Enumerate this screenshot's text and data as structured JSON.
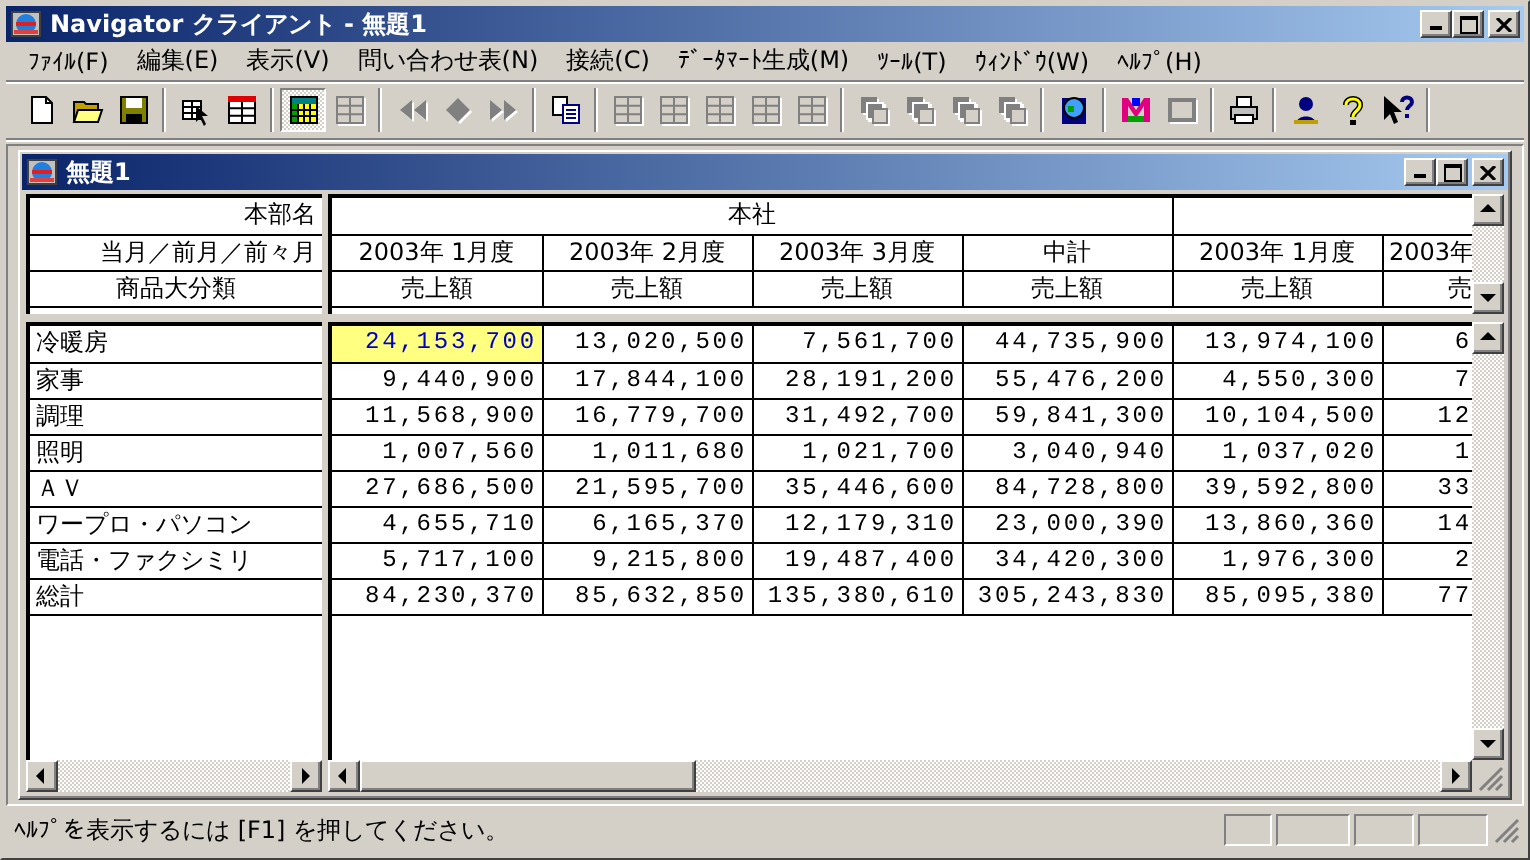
{
  "window": {
    "title": "Navigator クライアント - 無題1"
  },
  "menu": [
    "ﾌｧｲﾙ(F)",
    "編集(E)",
    "表示(V)",
    "問い合わせ表(N)",
    "接続(C)",
    "ﾃﾞｰﾀﾏｰﾄ生成(M)",
    "ﾂｰﾙ(T)",
    "ｳｨﾝﾄﾞｳ(W)",
    "ﾍﾙﾌﾟ(H)"
  ],
  "toolbar": [
    {
      "kind": "button",
      "disabled": false,
      "on": false
    },
    {
      "kind": "button",
      "disabled": false,
      "on": false
    },
    {
      "kind": "button",
      "disabled": false,
      "on": false
    },
    {
      "kind": "separator"
    },
    {
      "kind": "button",
      "disabled": false,
      "on": false
    },
    {
      "kind": "button",
      "disabled": false,
      "on": false
    },
    {
      "kind": "separator"
    },
    {
      "kind": "button",
      "disabled": false,
      "on": true
    },
    {
      "kind": "button",
      "disabled": true,
      "on": false
    },
    {
      "kind": "separator"
    },
    {
      "kind": "button",
      "disabled": true,
      "on": false
    },
    {
      "kind": "button",
      "disabled": true,
      "on": false
    },
    {
      "kind": "button",
      "disabled": true,
      "on": false
    },
    {
      "kind": "separator"
    },
    {
      "kind": "button",
      "disabled": false,
      "on": false
    },
    {
      "kind": "separator"
    },
    {
      "kind": "button",
      "disabled": true,
      "on": false
    },
    {
      "kind": "button",
      "disabled": true,
      "on": false
    },
    {
      "kind": "button",
      "disabled": true,
      "on": false
    },
    {
      "kind": "button",
      "disabled": true,
      "on": false
    },
    {
      "kind": "button",
      "disabled": true,
      "on": false
    },
    {
      "kind": "separator"
    },
    {
      "kind": "button",
      "disabled": true,
      "on": false
    },
    {
      "kind": "button",
      "disabled": true,
      "on": false
    },
    {
      "kind": "button",
      "disabled": true,
      "on": false
    },
    {
      "kind": "button",
      "disabled": true,
      "on": false
    },
    {
      "kind": "separator"
    },
    {
      "kind": "button",
      "disabled": false,
      "on": false
    },
    {
      "kind": "separator"
    },
    {
      "kind": "button",
      "disabled": false,
      "on": false
    },
    {
      "kind": "button",
      "disabled": true,
      "on": false
    },
    {
      "kind": "separator"
    },
    {
      "kind": "button",
      "disabled": false,
      "on": false
    },
    {
      "kind": "separator"
    },
    {
      "kind": "button",
      "disabled": false,
      "on": false
    },
    {
      "kind": "button",
      "disabled": false,
      "on": false
    },
    {
      "kind": "button",
      "disabled": false,
      "on": false
    },
    {
      "kind": "separator"
    }
  ],
  "document": {
    "title": "無題1",
    "grid": {
      "corner": [
        "本部名",
        "当月／前月／前々月",
        "商品大分類"
      ],
      "groups": [
        "本社"
      ],
      "periods": [
        "2003年 1月度",
        "2003年 2月度",
        "2003年 3月度",
        "中計",
        "2003年 1月度",
        "2003年"
      ],
      "measures": [
        "売上額",
        "売上額",
        "売上額",
        "売上額",
        "売上額",
        "売"
      ],
      "rows": [
        {
          "label": "冷暖房",
          "cells": [
            {
              "text": "24,153,700",
              "selected": true
            },
            {
              "text": "13,020,500",
              "selected": false
            },
            {
              "text": "7,561,700",
              "selected": false
            },
            {
              "text": "44,735,900",
              "selected": false
            },
            {
              "text": "13,974,100",
              "selected": false
            },
            {
              "text": "6",
              "selected": false
            }
          ]
        },
        {
          "label": "家事",
          "cells": [
            {
              "text": "9,440,900",
              "selected": false
            },
            {
              "text": "17,844,100",
              "selected": false
            },
            {
              "text": "28,191,200",
              "selected": false
            },
            {
              "text": "55,476,200",
              "selected": false
            },
            {
              "text": "4,550,300",
              "selected": false
            },
            {
              "text": "7",
              "selected": false
            }
          ]
        },
        {
          "label": "調理",
          "cells": [
            {
              "text": "11,568,900",
              "selected": false
            },
            {
              "text": "16,779,700",
              "selected": false
            },
            {
              "text": "31,492,700",
              "selected": false
            },
            {
              "text": "59,841,300",
              "selected": false
            },
            {
              "text": "10,104,500",
              "selected": false
            },
            {
              "text": "12",
              "selected": false
            }
          ]
        },
        {
          "label": "照明",
          "cells": [
            {
              "text": "1,007,560",
              "selected": false
            },
            {
              "text": "1,011,680",
              "selected": false
            },
            {
              "text": "1,021,700",
              "selected": false
            },
            {
              "text": "3,040,940",
              "selected": false
            },
            {
              "text": "1,037,020",
              "selected": false
            },
            {
              "text": "1",
              "selected": false
            }
          ]
        },
        {
          "label": "ＡＶ",
          "cells": [
            {
              "text": "27,686,500",
              "selected": false
            },
            {
              "text": "21,595,700",
              "selected": false
            },
            {
              "text": "35,446,600",
              "selected": false
            },
            {
              "text": "84,728,800",
              "selected": false
            },
            {
              "text": "39,592,800",
              "selected": false
            },
            {
              "text": "33",
              "selected": false
            }
          ]
        },
        {
          "label": "ワープロ・パソコン",
          "cells": [
            {
              "text": "4,655,710",
              "selected": false
            },
            {
              "text": "6,165,370",
              "selected": false
            },
            {
              "text": "12,179,310",
              "selected": false
            },
            {
              "text": "23,000,390",
              "selected": false
            },
            {
              "text": "13,860,360",
              "selected": false
            },
            {
              "text": "14",
              "selected": false
            }
          ]
        },
        {
          "label": "電話・ファクシミリ",
          "cells": [
            {
              "text": "5,717,100",
              "selected": false
            },
            {
              "text": "9,215,800",
              "selected": false
            },
            {
              "text": "19,487,400",
              "selected": false
            },
            {
              "text": "34,420,300",
              "selected": false
            },
            {
              "text": "1,976,300",
              "selected": false
            },
            {
              "text": "2",
              "selected": false
            }
          ]
        },
        {
          "label": "総計",
          "cells": [
            {
              "text": "84,230,370",
              "selected": false
            },
            {
              "text": "85,632,850",
              "selected": false
            },
            {
              "text": "135,380,610",
              "selected": false
            },
            {
              "text": "305,243,830",
              "selected": false
            },
            {
              "text": "85,095,380",
              "selected": false
            },
            {
              "text": "77",
              "selected": false
            }
          ]
        }
      ]
    }
  },
  "status_bar": {
    "message": "ﾍﾙﾌﾟを表示するには [F1] を押してください。"
  }
}
